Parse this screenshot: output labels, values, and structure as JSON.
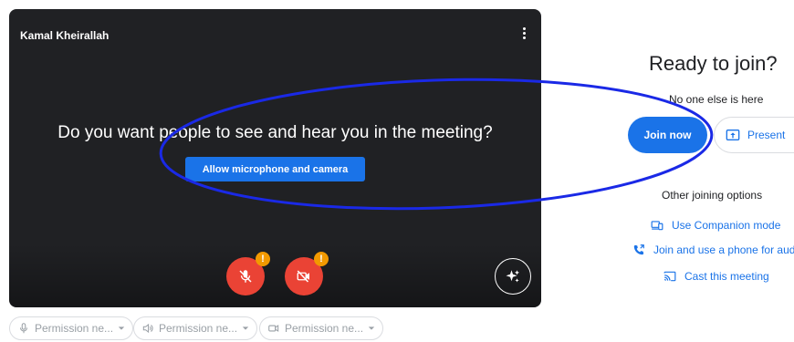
{
  "video": {
    "user_name": "Kamal Kheirallah",
    "prompt": "Do you want people to see and hear you in the meeting?",
    "allow_label": "Allow microphone and camera",
    "badge_mic": "!",
    "badge_cam": "!"
  },
  "permissions": [
    {
      "icon": "mic-icon",
      "label": "Permission ne..."
    },
    {
      "icon": "speaker-icon",
      "label": "Permission ne..."
    },
    {
      "icon": "camera-icon",
      "label": "Permission ne..."
    }
  ],
  "panel": {
    "title": "Ready to join?",
    "subtitle": "No one else is here",
    "join_label": "Join now",
    "present_label": "Present",
    "other_options": "Other joining options",
    "companion_label": "Use Companion mode",
    "phone_label": "Join and use a phone for audio",
    "cast_label": "Cast this meeting"
  },
  "colors": {
    "accent": "#1a73e8",
    "muted_red": "#ea4335",
    "badge": "#f29900",
    "annotation": "#1a29e6"
  }
}
